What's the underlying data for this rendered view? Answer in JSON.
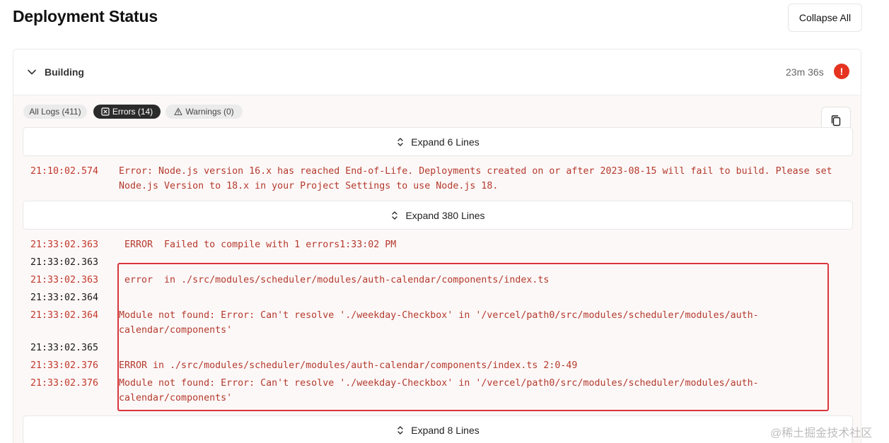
{
  "page": {
    "title": "Deployment Status",
    "collapse_all_label": "Collapse All"
  },
  "build": {
    "status_label": "Building",
    "duration": "23m 36s",
    "error_indicator": "!"
  },
  "filters": {
    "all": "All Logs (411)",
    "errors": "Errors (14)",
    "warnings": "Warnings (0)",
    "selected": "Errors (14)"
  },
  "expanders": [
    "Expand 6 Lines",
    "Expand 380 Lines",
    "Expand 8 Lines"
  ],
  "logs": [
    {
      "time": "21:10:02.574",
      "message": "Error: Node.js version 16.x has reached End-of-Life. Deployments created on or after 2023-08-15 will fail to build. Please set Node.js Version to 18.x in your Project Settings to use Node.js 18.",
      "level": "error"
    },
    {
      "time": "21:33:02.363",
      "message": " ERROR  Failed to compile with 1 errors1:33:02 PM",
      "level": "error"
    },
    {
      "time": "21:33:02.363",
      "message": "",
      "level": "info"
    },
    {
      "time": "21:33:02.363",
      "message": " error  in ./src/modules/scheduler/modules/auth-calendar/components/index.ts",
      "level": "error"
    },
    {
      "time": "21:33:02.364",
      "message": "",
      "level": "info"
    },
    {
      "time": "21:33:02.364",
      "message": "Module not found: Error: Can't resolve './weekday-Checkbox' in '/vercel/path0/src/modules/scheduler/modules/auth-calendar/components'",
      "level": "error"
    },
    {
      "time": "21:33:02.365",
      "message": "",
      "level": "info"
    },
    {
      "time": "21:33:02.376",
      "message": "ERROR in ./src/modules/scheduler/modules/auth-calendar/components/index.ts 2:0-49",
      "level": "error"
    },
    {
      "time": "21:33:02.376",
      "message": "Module not found: Error: Can't resolve './weekday-Checkbox' in '/vercel/path0/src/modules/scheduler/modules/auth-calendar/components'",
      "level": "error"
    }
  ],
  "colors": {
    "error_text": "#b33a2c",
    "error_dot": "#e5331f",
    "highlight_box": "#d9363e",
    "log_background": "#fdf8f8"
  },
  "icons": {
    "collapse": "chevron-down-icon",
    "expand": "unfold-vertical-icon",
    "errors": "x-square-icon",
    "warnings": "warning-triangle-icon",
    "copy": "copy-icon"
  },
  "watermark": "@稀土掘金技术社区"
}
